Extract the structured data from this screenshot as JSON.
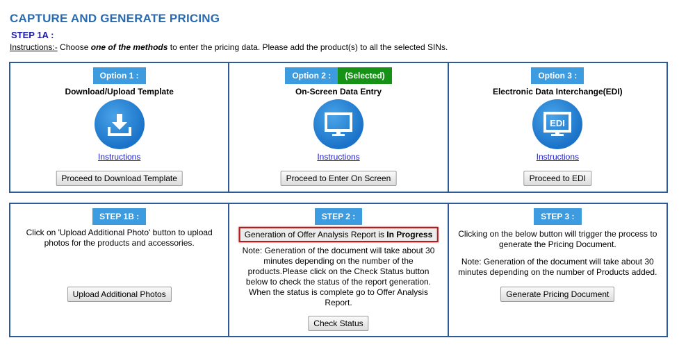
{
  "header": {
    "title": "CAPTURE AND GENERATE PRICING",
    "step": "STEP 1A :",
    "instructions_label": "Instructions:-",
    "instructions_pre": " Choose ",
    "instructions_emphasis": "one of the methods",
    "instructions_post": " to enter the pricing data. Please add the product(s) to all the selected SINs."
  },
  "options": [
    {
      "badge": "Option 1 :",
      "title": "Download/Upload Template",
      "icon": "download-icon",
      "link": "Instructions",
      "button": "Proceed to Download Template"
    },
    {
      "badge": "Option 2 :",
      "selected_label": "(Selected)",
      "title": "On-Screen Data Entry",
      "icon": "monitor-icon",
      "link": "Instructions",
      "button": "Proceed to Enter On Screen"
    },
    {
      "badge": "Option 3 :",
      "title": "Electronic Data Interchange(EDI)",
      "icon": "edi-icon",
      "icon_text": "EDI",
      "link": "Instructions",
      "button": "Proceed to EDI"
    }
  ],
  "steps": [
    {
      "badge": "STEP 1B :",
      "text": "Click on 'Upload Additional Photo' button to upload photos for the products and accessories.",
      "button": "Upload Additional Photos"
    },
    {
      "badge": "STEP 2 :",
      "status_prefix": "Generation of Offer Analysis Report is ",
      "status_value": "In Progress",
      "note": "Note: Generation of the document will take about 30 minutes depending on the number of the products.Please click on the Check Status button below to check the status of the report generation. When the status is complete go to Offer Analysis Report.",
      "button": "Check Status"
    },
    {
      "badge": "STEP 3 :",
      "text": "Clicking on the below button will trigger the process to generate the Pricing Document.",
      "note": "Note: Generation of the document will take about 30 minutes depending on the number of Products added.",
      "button": "Generate Pricing Document"
    }
  ],
  "colors": {
    "title": "#2a6bb0",
    "badge": "#3d9be0",
    "selected": "#169216",
    "border": "#2e5a9c",
    "highlight_border": "#b01e1e"
  }
}
